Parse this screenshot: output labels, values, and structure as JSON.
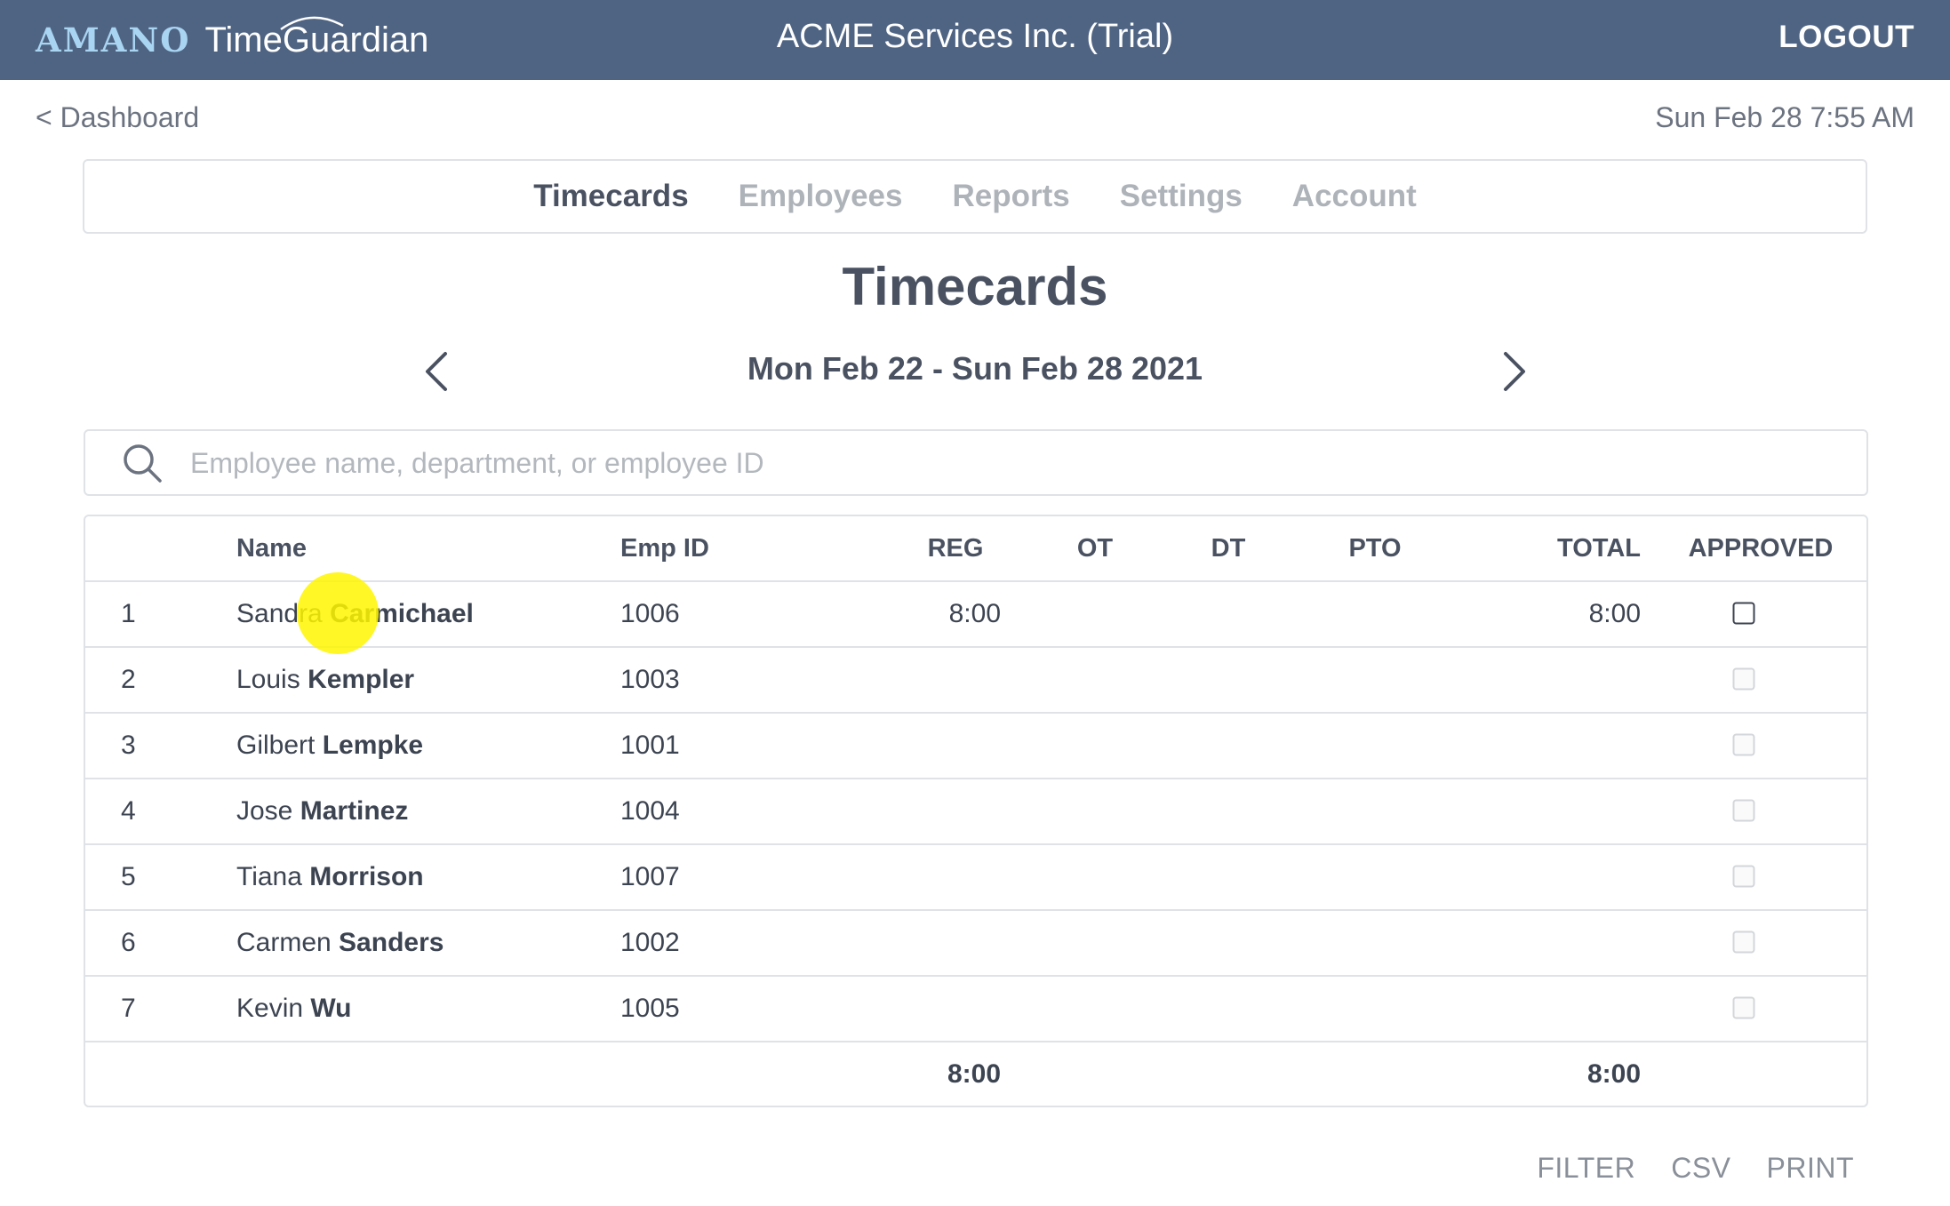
{
  "header": {
    "brand": "AMANO",
    "product": "TimeGuardian",
    "company": "ACME Services Inc. (Trial)",
    "logout_label": "LOGOUT"
  },
  "subheader": {
    "back_label": "< Dashboard",
    "datetime": "Sun Feb 28 7:55 AM"
  },
  "nav": {
    "tabs": [
      {
        "label": "Timecards",
        "active": true
      },
      {
        "label": "Employees",
        "active": false
      },
      {
        "label": "Reports",
        "active": false
      },
      {
        "label": "Settings",
        "active": false
      },
      {
        "label": "Account",
        "active": false
      }
    ]
  },
  "page": {
    "title": "Timecards",
    "week_range": "Mon Feb 22 - Sun Feb 28 2021"
  },
  "search": {
    "placeholder": "Employee name, department, or employee ID",
    "value": ""
  },
  "table": {
    "columns": [
      "Name",
      "Emp ID",
      "REG",
      "OT",
      "DT",
      "PTO",
      "TOTAL",
      "APPROVED"
    ],
    "rows": [
      {
        "num": "1",
        "first": "Sandra",
        "last": "Carmichael",
        "emp_id": "1006",
        "reg": "8:00",
        "ot": "",
        "dt": "",
        "pto": "",
        "total": "8:00",
        "approved": false,
        "approve_enabled": true
      },
      {
        "num": "2",
        "first": "Louis",
        "last": "Kempler",
        "emp_id": "1003",
        "reg": "",
        "ot": "",
        "dt": "",
        "pto": "",
        "total": "",
        "approved": false,
        "approve_enabled": false
      },
      {
        "num": "3",
        "first": "Gilbert",
        "last": "Lempke",
        "emp_id": "1001",
        "reg": "",
        "ot": "",
        "dt": "",
        "pto": "",
        "total": "",
        "approved": false,
        "approve_enabled": false
      },
      {
        "num": "4",
        "first": "Jose",
        "last": "Martinez",
        "emp_id": "1004",
        "reg": "",
        "ot": "",
        "dt": "",
        "pto": "",
        "total": "",
        "approved": false,
        "approve_enabled": false
      },
      {
        "num": "5",
        "first": "Tiana",
        "last": "Morrison",
        "emp_id": "1007",
        "reg": "",
        "ot": "",
        "dt": "",
        "pto": "",
        "total": "",
        "approved": false,
        "approve_enabled": false
      },
      {
        "num": "6",
        "first": "Carmen",
        "last": "Sanders",
        "emp_id": "1002",
        "reg": "",
        "ot": "",
        "dt": "",
        "pto": "",
        "total": "",
        "approved": false,
        "approve_enabled": false
      },
      {
        "num": "7",
        "first": "Kevin",
        "last": "Wu",
        "emp_id": "1005",
        "reg": "",
        "ot": "",
        "dt": "",
        "pto": "",
        "total": "",
        "approved": false,
        "approve_enabled": false
      }
    ],
    "totals": {
      "reg": "8:00",
      "total": "8:00"
    }
  },
  "actions": {
    "filter_label": "FILTER",
    "csv_label": "CSV",
    "print_label": "PRINT"
  },
  "colors": {
    "header_bg": "#4f6483",
    "brand_accent": "#a9d4f2",
    "cursor_highlight": "#fff600"
  },
  "icons": {
    "prev": "chevron-left-icon",
    "next": "chevron-right-icon",
    "search": "search-icon"
  }
}
